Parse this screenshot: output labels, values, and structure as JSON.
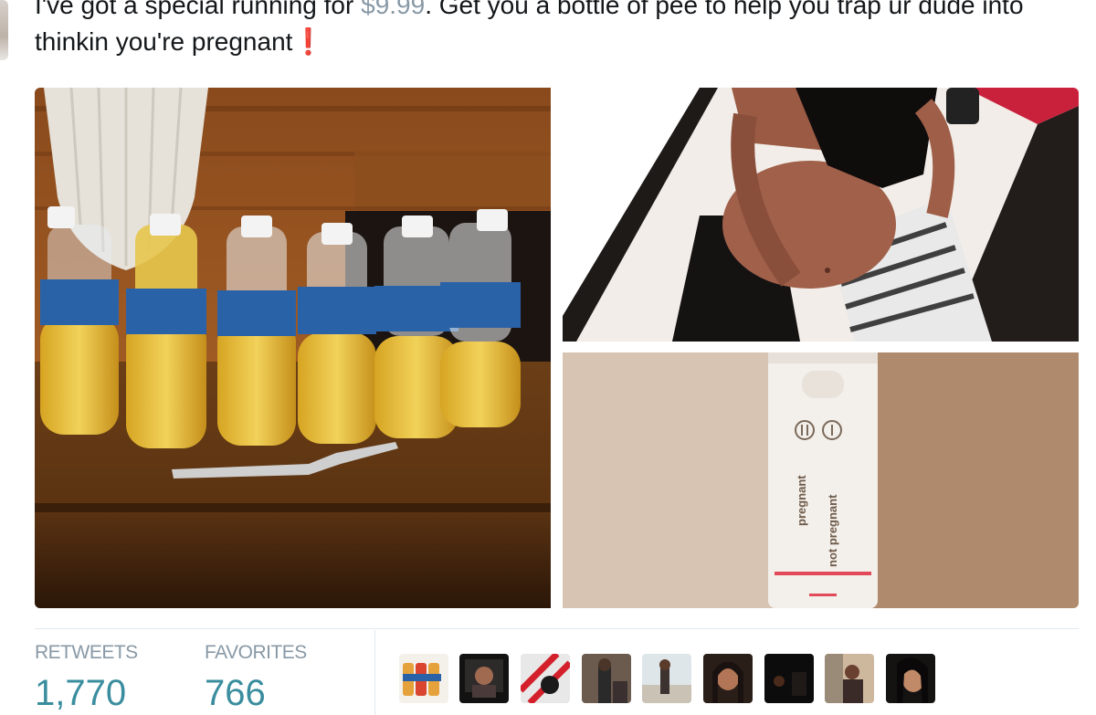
{
  "tweet": {
    "text_part1": "I've got a special running for",
    "price": "$9.99",
    "text_part2": ". Get you a bottle of pee to help you trap ur dude into thinkin you're pregnant",
    "exclamation": "❗"
  },
  "media": {
    "photos": [
      "bottles-photo",
      "pregnant-selfie-photo",
      "pregnancy-test-photo"
    ],
    "test_labels": {
      "pregnant": "pregnant",
      "not_pregnant": "not pregnant"
    }
  },
  "stats": {
    "retweets": {
      "label": "RETWEETS",
      "value": "1,770"
    },
    "favorites": {
      "label": "FAVORITES",
      "value": "766"
    }
  },
  "favoriters": [
    "avatar-1",
    "avatar-2",
    "avatar-3",
    "avatar-4",
    "avatar-5",
    "avatar-6",
    "avatar-7",
    "avatar-8",
    "avatar-9"
  ],
  "colors": {
    "stat_label": "#8899a6",
    "stat_value": "#3a8d9e",
    "price": "#8899a6",
    "exclamation": "#e0245e"
  }
}
